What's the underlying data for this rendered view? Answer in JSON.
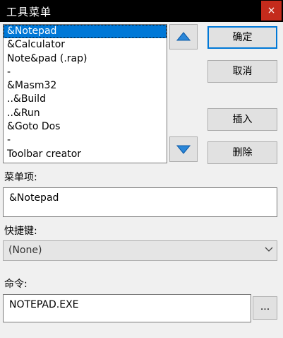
{
  "window": {
    "title": "工具菜单",
    "close_glyph": "×"
  },
  "list": {
    "items": [
      "&Notepad",
      "&Calculator",
      "Note&pad (.rap)",
      "-",
      "&Masm32",
      "..&Build",
      "..&Run",
      "&Goto Dos",
      "-",
      "Toolbar creator"
    ],
    "selected_index": 0
  },
  "buttons": {
    "ok": "确定",
    "cancel": "取消",
    "insert": "插入",
    "delete": "删除",
    "browse": "..."
  },
  "icons": {
    "up": "up-arrow-icon",
    "down": "down-arrow-icon",
    "dropdown": "chevron-down-icon"
  },
  "form": {
    "menu_item_label": "菜单项:",
    "menu_item_value": "&Notepad",
    "shortcut_label": "快捷键:",
    "shortcut_value": "(None)",
    "command_label": "命令:",
    "command_value": "NOTEPAD.EXE"
  },
  "colors": {
    "accent": "#0078d7",
    "close": "#c42b1c",
    "titlebar": "#000000"
  }
}
